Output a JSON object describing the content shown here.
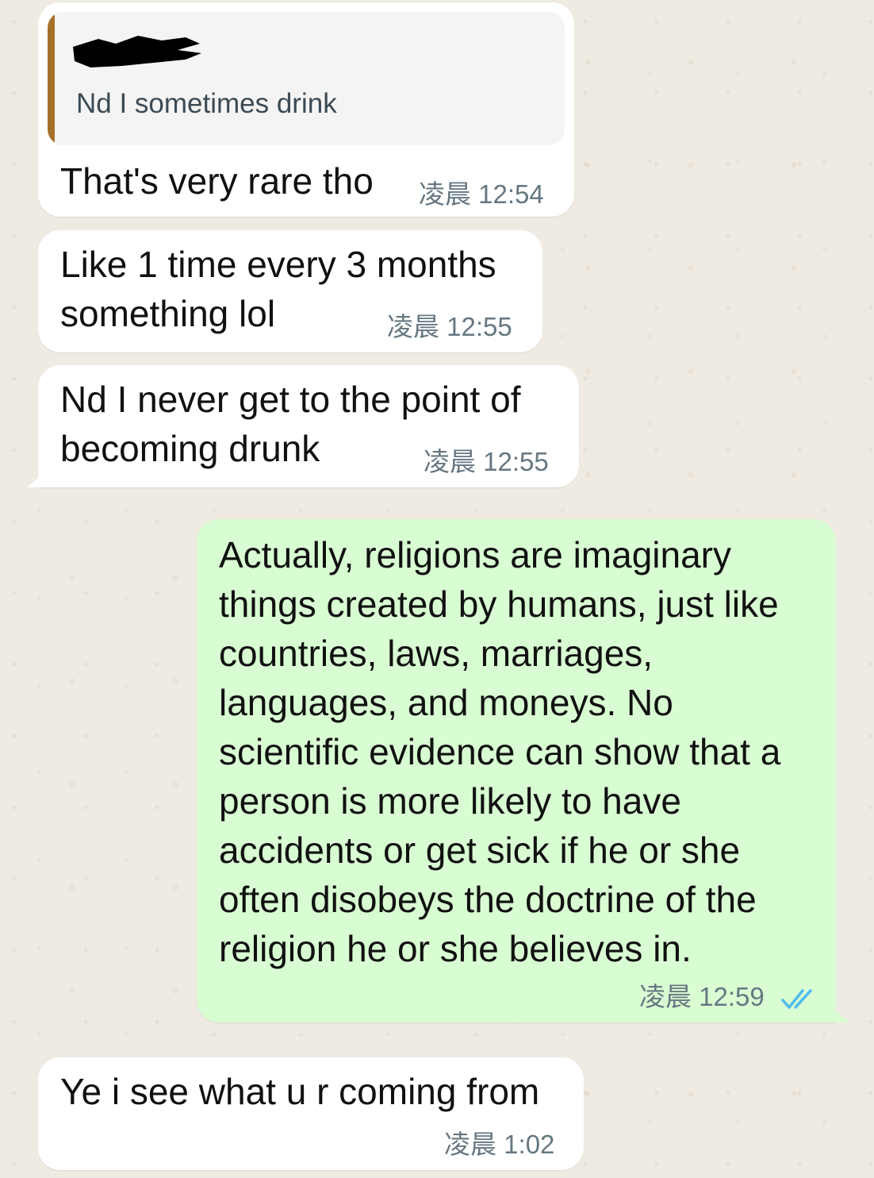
{
  "colors": {
    "background": "#efeae2",
    "incoming_bubble": "#ffffff",
    "outgoing_bubble": "#d9fdd3",
    "quote_bar": "#a5712a",
    "timestamp": "#667781",
    "read_ticks": "#53bdeb"
  },
  "messages": [
    {
      "direction": "incoming",
      "quoted": {
        "sender": "[redacted]",
        "text": "Nd I sometimes drink"
      },
      "text": "That's very rare tho",
      "time": "凌晨 12:54"
    },
    {
      "direction": "incoming",
      "text": "Like 1 time every 3 months\nsomething lol",
      "time": "凌晨 12:55"
    },
    {
      "direction": "incoming",
      "text": "Nd I never get to the point of\nbecoming drunk",
      "time": "凌晨 12:55"
    },
    {
      "direction": "outgoing",
      "text": "Actually, religions are imaginary\nthings created by humans, just like\ncountries, laws, marriages,\nlanguages, and moneys. No\nscientific evidence can show that a\nperson is more likely to have\naccidents or get sick if he or she\noften disobeys the doctrine of the\nreligion he or she believes in.",
      "time": "凌晨 12:59",
      "status_icon": "double-check-read-icon"
    },
    {
      "direction": "incoming",
      "text": "Ye i see what u r coming from",
      "time": "凌晨 1:02"
    }
  ]
}
